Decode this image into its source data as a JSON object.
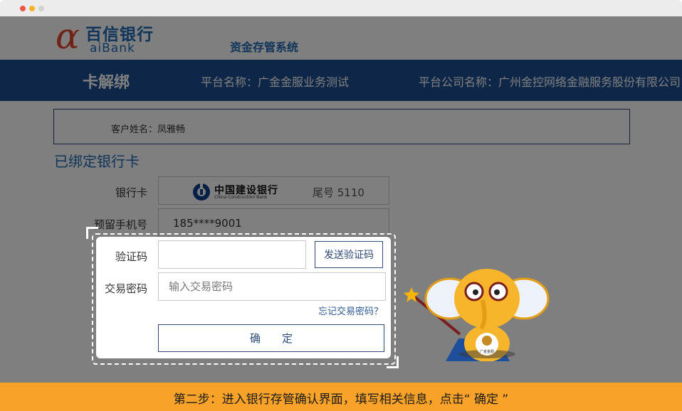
{
  "colors": {
    "accent_blue": "#2e4b78",
    "bar_blue": "#1d4e91",
    "logo_red": "#e0452c",
    "logo_blue": "#1f6ab4",
    "bottom_orange": "#f8a229",
    "dot_red": "#f0564b",
    "dot_yellow": "#f3b62b",
    "dot_green": "#cfd3cf"
  },
  "header": {
    "logo_mark": "α",
    "logo_cn": "百信银行",
    "logo_en": "aiBank",
    "system_title": "资金存管系统"
  },
  "bar": {
    "title": "卡解绑",
    "platform": "平台名称：广金金服业务测试",
    "company": "平台公司名称：广州金控网络金融服务股份有限公司"
  },
  "customer": {
    "label_value": "客户姓名：凤雅畅"
  },
  "bound_card": {
    "section_title": "已绑定银行卡",
    "card_label": "银行卡",
    "bank_name_cn": "中国建设银行",
    "bank_name_en": "China Construction Bank",
    "tail_number": "尾号 5110",
    "phone_label": "预留手机号",
    "phone_value": "185****9001"
  },
  "dialog": {
    "code_label": "验证码",
    "code_value": "",
    "send_code_button": "发送验证码",
    "password_label": "交易密码",
    "password_placeholder": "输入交易密码",
    "forgot_link": "忘记交易密码？",
    "confirm_button": "确定"
  },
  "mascot": {
    "badge_text": "广金金服",
    "icon": "elephant-mascot-icon"
  },
  "footer": {
    "instruction": "第二步：进入银行存管确认界面，填写相关信息，点击“ 确定 ”"
  }
}
